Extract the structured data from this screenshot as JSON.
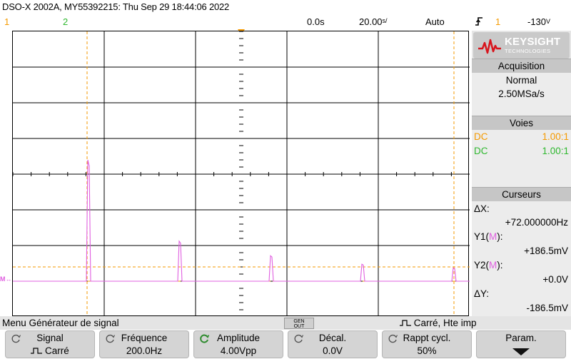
{
  "header": {
    "title": "DSO-X 2002A, MY55392215: Thu Sep 29 18:44:06 2022"
  },
  "status_bar": {
    "ch1_number": "1",
    "ch2_number": "2",
    "time_offset": "0.0s",
    "time_scale_value": "20.00",
    "time_scale_unit": "s/",
    "trigger_mode": "Auto",
    "trigger_icon": "rising-edge-icon",
    "trigger_channel": "1",
    "trigger_level_value": "-130",
    "trigger_level_unit": "V"
  },
  "colors": {
    "channel1": "#f59a00",
    "channel2": "#2fb82f",
    "math": "#e060e0",
    "grid": "#000000"
  },
  "display": {
    "math_marker": "M",
    "peaks_relative_amplitude": [
      1.0,
      0.33,
      0.21,
      0.14,
      0.11
    ],
    "peaks_frequency_hz": [
      200,
      600,
      1000,
      1400,
      1800
    ]
  },
  "right_panel": {
    "brand_name": "KEYSIGHT",
    "brand_sub": "TECHNOLOGIES",
    "acquisition": {
      "title": "Acquisition",
      "mode": "Normal",
      "sample_rate": "2.50MSa/s"
    },
    "channels": {
      "title": "Voies",
      "ch1_coupling": "DC",
      "ch1_probe": "1.00:1",
      "ch2_coupling": "DC",
      "ch2_probe": "1.00:1"
    },
    "cursors": {
      "title": "Curseurs",
      "dx_label": "ΔX:",
      "dx_value": "+72.000000Hz",
      "y1_prefix": "Y1(",
      "y1_src": "M",
      "y1_suffix": "):",
      "y1_value": "+186.5mV",
      "y2_prefix": "Y2(",
      "y2_src": "M",
      "y2_suffix": "):",
      "y2_value": "+0.0V",
      "dy_label": "ΔY:",
      "dy_value": "-186.5mV"
    }
  },
  "menu": {
    "title": "Menu Générateur de signal",
    "gen_out_line1": "GEN",
    "gen_out_line2": "OUT",
    "wave_desc": "Carré, Hte imp"
  },
  "softkeys": [
    {
      "label": "Signal",
      "value": "Carré"
    },
    {
      "label": "Fréquence",
      "value": "200.0Hz"
    },
    {
      "label": "Amplitude",
      "value": "4.00Vpp"
    },
    {
      "label": "Décal.",
      "value": "0.0V"
    },
    {
      "label": "Rappt cycl.",
      "value": "50%"
    },
    {
      "label": "Param.",
      "value": ""
    }
  ]
}
